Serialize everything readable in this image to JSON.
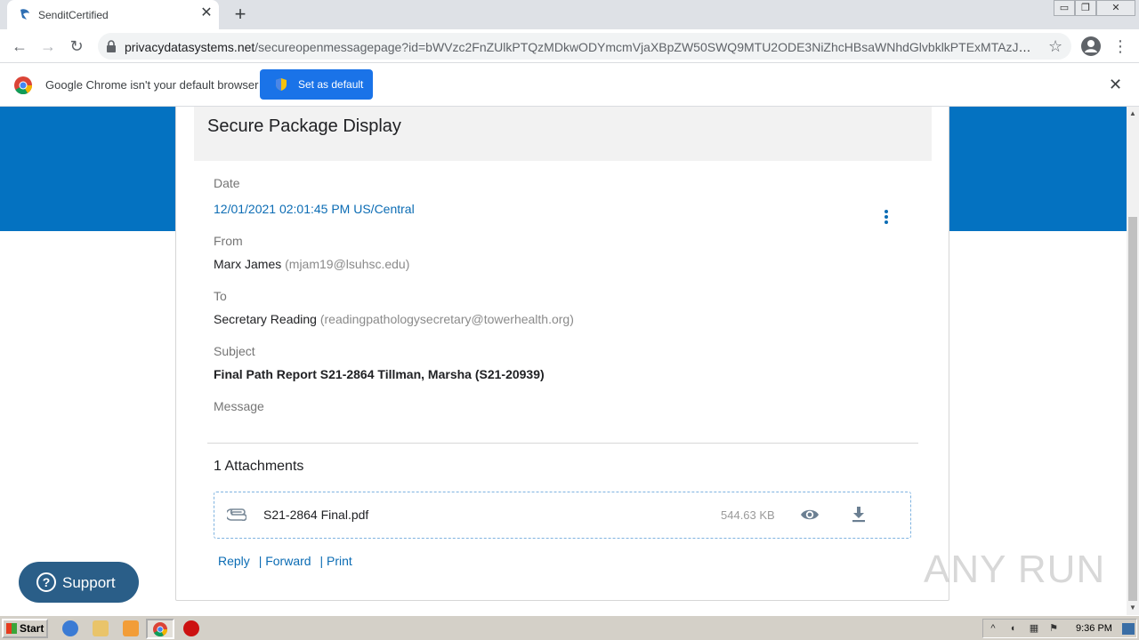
{
  "browser": {
    "tab_title": "SenditCertified",
    "tab_close_glyph": "✕",
    "new_tab_glyph": "+",
    "url_host": "privacydatasystems.net",
    "url_path": "/secureopenmessagepage?id=bWVzc2FnZUlkPTQzMDkwODYmcmVjaXBpZW50SWQ9MTU2ODE3NiZhcHBsaWNhdGlvbklkPTExMTAzJnNlbmRl...",
    "star_glyph": "☆",
    "menu_glyph": "⋮",
    "back_glyph": "←",
    "forward_glyph": "→",
    "reload_glyph": "↻",
    "window_controls": [
      "▭",
      "❐",
      "✕"
    ]
  },
  "infobar": {
    "message": "Google Chrome isn't your default browser",
    "button_label": "Set as default",
    "close_glyph": "✕"
  },
  "card": {
    "title": "Secure Package Display",
    "date_label": "Date",
    "date_value": "12/01/2021 02:01:45 PM  US/Central",
    "from_label": "From",
    "from_name": "Marx James",
    "from_email": "(mjam19@lsuhsc.edu)",
    "to_label": "To",
    "to_name": "Secretary Reading",
    "to_email": "(readingpathologysecretary@towerhealth.org)",
    "subject_label": "Subject",
    "subject_value": "Final Path Report S21-2864 Tillman, Marsha (S21-20939)",
    "message_label": "Message",
    "attachments_title": "1 Attachments",
    "attachment": {
      "file_name": "S21-2864 Final.pdf",
      "file_size": "544.63 KB",
      "icons": [
        "paperclip-icon",
        "eye-icon",
        "download-icon"
      ]
    },
    "actions": {
      "reply": "Reply",
      "forward": "| Forward",
      "print": "| Print"
    }
  },
  "support": {
    "label": "Support",
    "icon_glyph": "?"
  },
  "watermark": "ANY RUN",
  "taskbar": {
    "start_label": "Start",
    "clock": "9:36 PM"
  },
  "colors": {
    "brand_blue": "#0472c1",
    "link_blue": "#0b6cb4",
    "chrome_button": "#1a73e8",
    "support_bg": "#2a5e88"
  }
}
